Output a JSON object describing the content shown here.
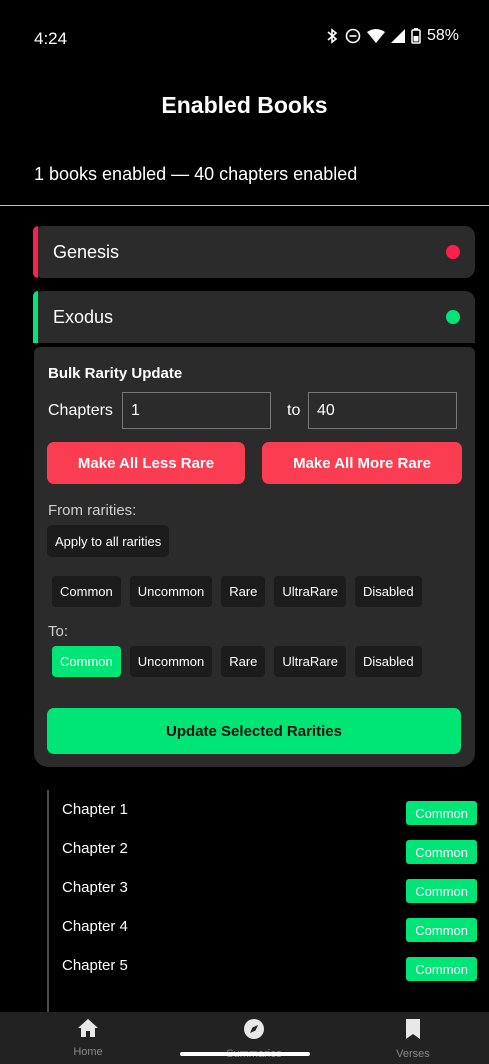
{
  "status_bar": {
    "time": "4:24",
    "battery": "58%"
  },
  "header": {
    "title": "Enabled Books",
    "summary": "1 books enabled — 40 chapters enabled"
  },
  "books": [
    {
      "name": "Genesis",
      "status_color": "#ff1f4f",
      "accent_color": "#ff1f4f"
    },
    {
      "name": "Exodus",
      "status_color": "#00e676",
      "accent_color": "#00e676"
    }
  ],
  "bulk_update": {
    "title": "Bulk Rarity Update",
    "chapters_label": "Chapters",
    "from_value": "1",
    "to_label": "to",
    "to_value": "40",
    "less_rare_label": "Make All Less Rare",
    "more_rare_label": "Make All More Rare",
    "from_rarities_label": "From rarities:",
    "apply_all_label": "Apply to all rarities",
    "from_options": [
      "Common",
      "Uncommon",
      "Rare",
      "UltraRare",
      "Disabled"
    ],
    "to_section_label": "To:",
    "to_options": [
      "Common",
      "Uncommon",
      "Rare",
      "UltraRare",
      "Disabled"
    ],
    "to_selected": "Common",
    "update_label": "Update Selected Rarities"
  },
  "chapters": [
    {
      "name": "Chapter 1",
      "rarity": "Common"
    },
    {
      "name": "Chapter 2",
      "rarity": "Common"
    },
    {
      "name": "Chapter 3",
      "rarity": "Common"
    },
    {
      "name": "Chapter 4",
      "rarity": "Common"
    },
    {
      "name": "Chapter 5",
      "rarity": "Common"
    }
  ],
  "bottom_nav": [
    {
      "label": "Home",
      "icon": "home-icon"
    },
    {
      "label": "Summaries",
      "icon": "compass-icon"
    },
    {
      "label": "Verses",
      "icon": "bookmark-icon"
    }
  ],
  "colors": {
    "accent_green": "#00e676",
    "accent_red": "#fb3d52",
    "panel_bg": "#2b2b2b"
  }
}
